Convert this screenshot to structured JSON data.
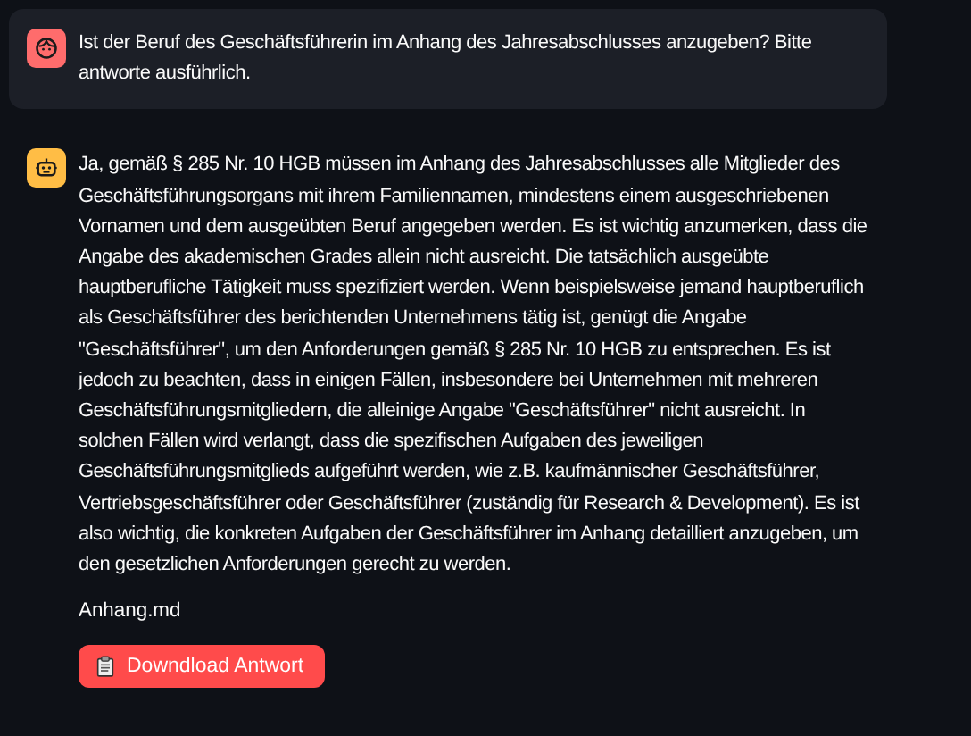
{
  "messages": [
    {
      "kind": "user",
      "text": "Ist der Beruf des Geschäftsführerin im Anhang des Jahresabschlusses anzugeben? Bitte antworte ausführlich."
    },
    {
      "kind": "assistant",
      "text": "Ja, gemäß § 285 Nr. 10 HGB müssen im Anhang des Jahresabschlusses alle Mitglieder des Geschäftsführungsorgans mit ihrem Familiennamen, mindestens einem ausgeschriebenen Vornamen und dem ausgeübten Beruf angegeben werden. Es ist wichtig anzumerken, dass die Angabe des akademischen Grades allein nicht ausreicht. Die tatsächlich ausgeübte hauptberufliche Tätigkeit muss spezifiziert werden. Wenn beispielsweise jemand hauptberuflich als Geschäftsführer des berichtenden Unternehmens tätig ist, genügt die Angabe \"Geschäftsführer\", um den Anforderungen gemäß § 285 Nr. 10 HGB zu entsprechen. Es ist jedoch zu beachten, dass in einigen Fällen, insbesondere bei Unternehmen mit mehreren Geschäftsführungsmitgliedern, die alleinige Angabe \"Geschäftsführer\" nicht ausreicht. In solchen Fällen wird verlangt, dass die spezifischen Aufgaben des jeweiligen Geschäftsführungsmitglieds aufgeführt werden, wie z.B. kaufmännischer Geschäftsführer, Vertriebsgeschäftsführer oder Geschäftsführer (zuständig für Research & Development). Es ist also wichtig, die konkreten Aufgaben der Geschäftsführer im Anhang detailliert anzugeben, um den gesetzlichen Anforderungen gerecht zu werden.",
      "source": "Anhang.md",
      "button": "Downdload Antwort"
    }
  ]
}
